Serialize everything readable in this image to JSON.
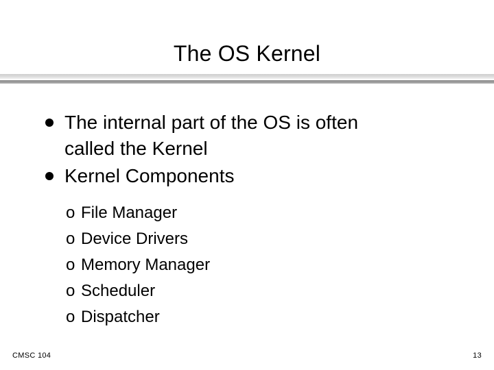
{
  "slide": {
    "title": "The OS Kernel",
    "background_color": "#ffffff",
    "text_color": "#000000",
    "divider": {
      "light_band_color": "#d9d9d9",
      "dark_band_color": "#9c9c9c"
    },
    "bullets": [
      {
        "marker": "filled-circle-bullet",
        "text": "The internal part of the OS is often called the Kernel"
      },
      {
        "marker": "filled-circle-bullet",
        "text": "Kernel Components"
      }
    ],
    "sub_items": [
      {
        "marker": "o",
        "text": "File Manager"
      },
      {
        "marker": "o",
        "text": "Device Drivers"
      },
      {
        "marker": "o",
        "text": "Memory Manager"
      },
      {
        "marker": "o",
        "text": "Scheduler"
      },
      {
        "marker": "o",
        "text": "Dispatcher"
      }
    ],
    "footer": {
      "course": "CMSC 104",
      "page_number": "13"
    }
  }
}
